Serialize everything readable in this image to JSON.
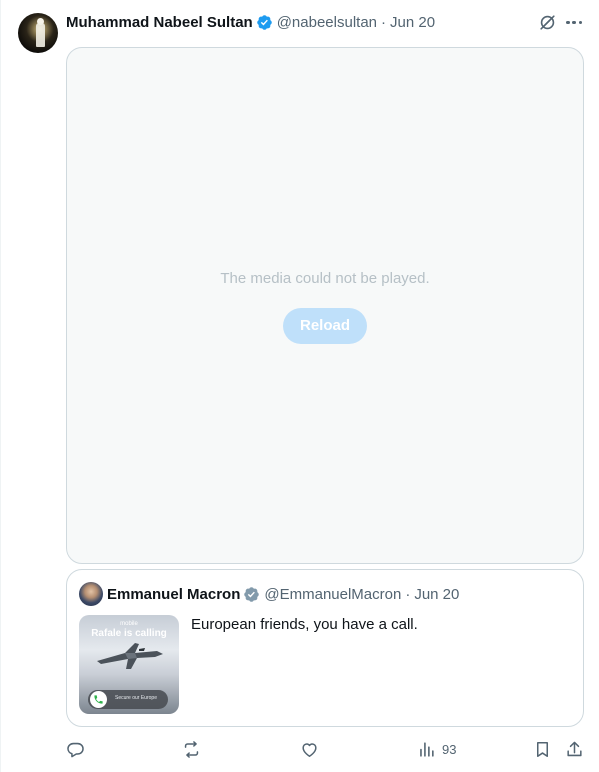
{
  "post": {
    "author_name": "Muhammad Nabeel Sultan",
    "author_handle": "@nabeelsultan",
    "separator": "·",
    "date": "Jun 20",
    "verified_color": "#1d9bf0"
  },
  "media": {
    "error_message": "The media could not be played.",
    "reload_label": "Reload"
  },
  "quote": {
    "author_name": "Emmanuel Macron",
    "author_handle": "@EmmanuelMacron",
    "separator": "·",
    "date": "Jun 20",
    "verified_color": "#829aab",
    "text": "European friends, you have a call.",
    "thumbnail": {
      "caption_small": "mobile",
      "caption_title": "Rafale is calling",
      "call_label": "Secure our Europe"
    }
  },
  "actions": {
    "views_count": "93",
    "icons": [
      "reply-icon",
      "repost-icon",
      "like-icon",
      "views-icon",
      "bookmark-icon",
      "share-icon"
    ]
  },
  "colors": {
    "text_primary": "#0f1419",
    "text_secondary": "#536471",
    "border": "#cfd9de",
    "reload_bg": "#bfe0fa"
  }
}
